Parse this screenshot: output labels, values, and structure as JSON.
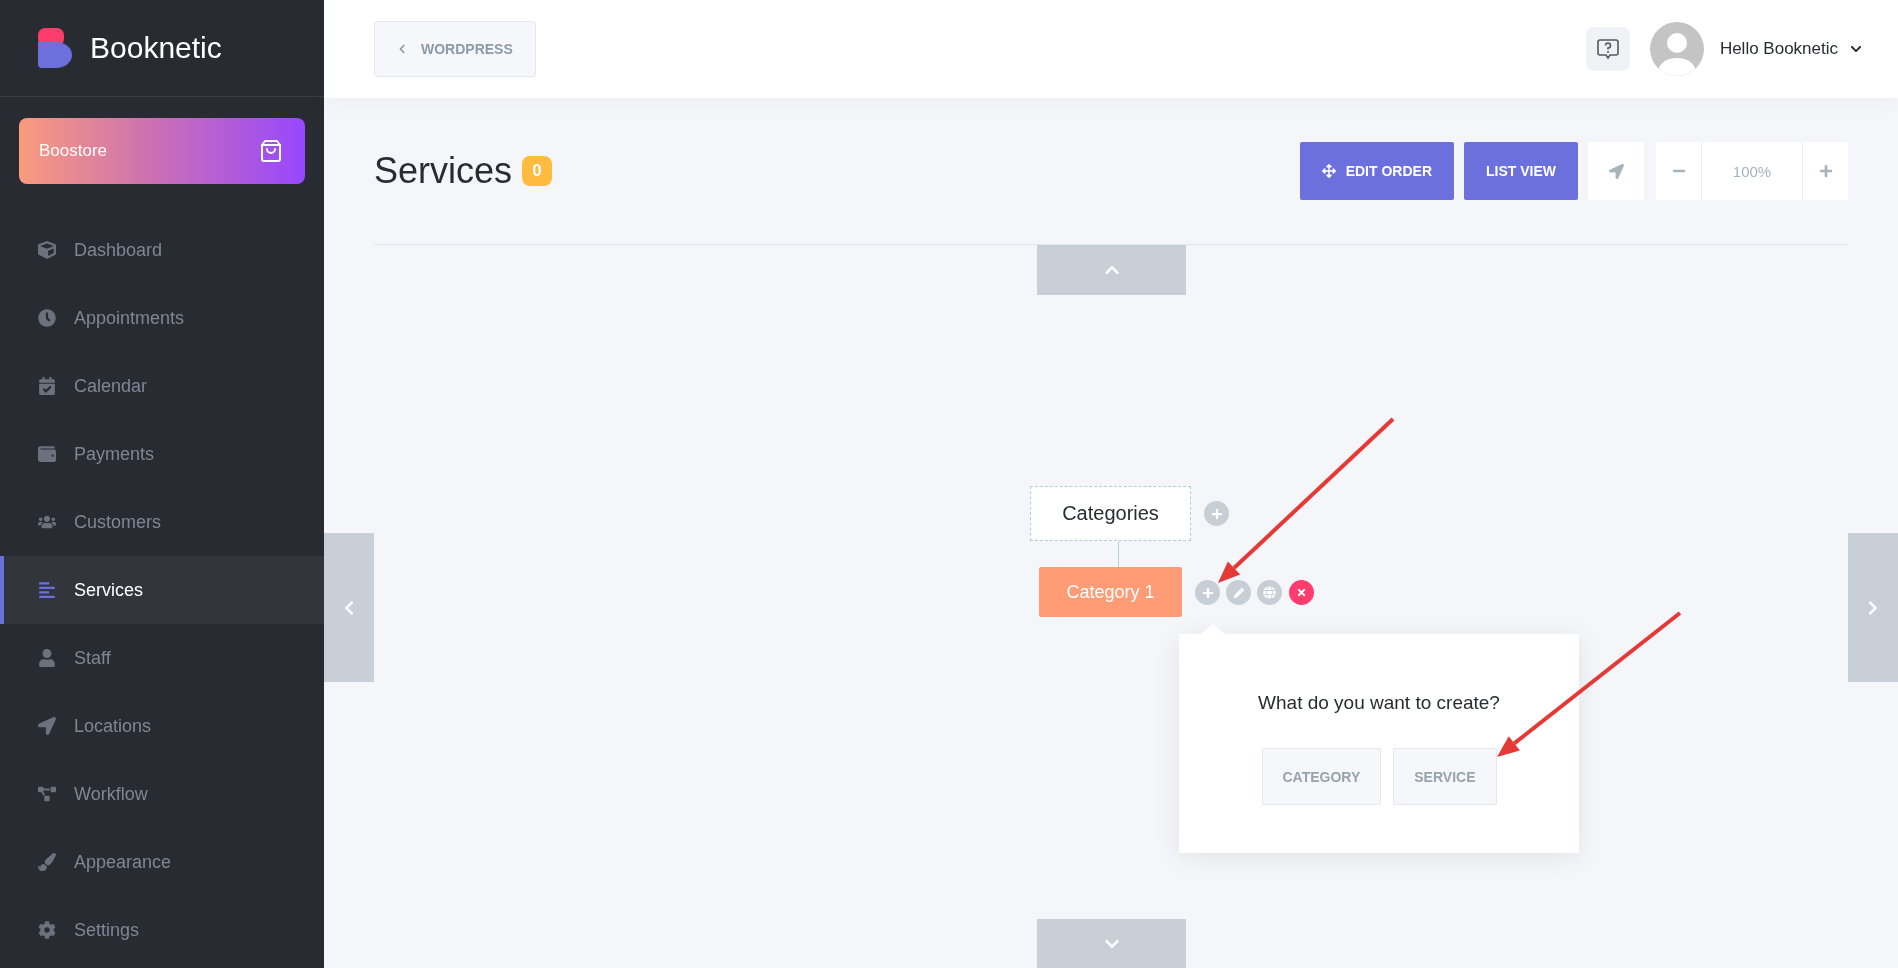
{
  "brand": {
    "name": "Booknetic"
  },
  "store_button": {
    "label": "Boostore"
  },
  "sidebar": {
    "items": [
      {
        "label": "Dashboard",
        "kind": "cube",
        "selected": false
      },
      {
        "label": "Appointments",
        "kind": "clock",
        "selected": false
      },
      {
        "label": "Calendar",
        "kind": "calendar",
        "selected": false
      },
      {
        "label": "Payments",
        "kind": "wallet",
        "selected": false
      },
      {
        "label": "Customers",
        "kind": "users",
        "selected": false
      },
      {
        "label": "Services",
        "kind": "lines",
        "selected": true
      },
      {
        "label": "Staff",
        "kind": "user",
        "selected": false
      },
      {
        "label": "Locations",
        "kind": "arrow",
        "selected": false
      },
      {
        "label": "Workflow",
        "kind": "diagram",
        "selected": false
      },
      {
        "label": "Appearance",
        "kind": "brush",
        "selected": false
      },
      {
        "label": "Settings",
        "kind": "gear",
        "selected": false
      }
    ]
  },
  "header": {
    "back_button": "WORDPRESS",
    "user_name": "Hello Booknetic"
  },
  "page": {
    "title": "Services",
    "count": "0"
  },
  "toolbar": {
    "buttons": [
      {
        "label": "EDIT ORDER",
        "kind": "move"
      },
      {
        "label": "LIST VIEW",
        "kind": "plain"
      }
    ],
    "zoom": "100%"
  },
  "tree": {
    "root": {
      "label": "Categories",
      "children": [
        {
          "label": "Category 1"
        }
      ]
    }
  },
  "popover": {
    "question": "What do you want to create?",
    "options": [
      "CATEGORY",
      "SERVICE"
    ]
  }
}
